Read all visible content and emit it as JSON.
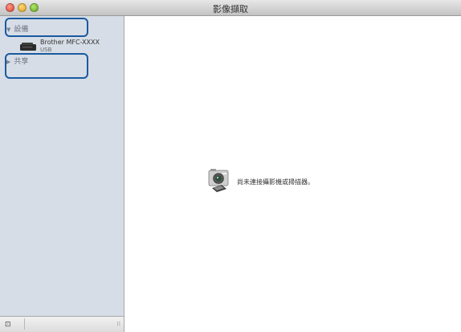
{
  "window": {
    "title": "影像擷取"
  },
  "sidebar": {
    "devices_header": "設備",
    "device": {
      "name": "Brother MFC-XXXX",
      "connection": "USB"
    },
    "shared_header": "共享"
  },
  "main": {
    "message": "尚未連接攝影機或掃描器。"
  },
  "icons": {
    "device": "printer-icon",
    "camera": "camera-icon",
    "devices_toggle": "disclosure-triangle-down-icon",
    "shared_toggle": "disclosure-triangle-right-icon"
  },
  "colors": {
    "sidebar_bg": "#d6dde6",
    "highlight_border": "#1a5aa0"
  }
}
